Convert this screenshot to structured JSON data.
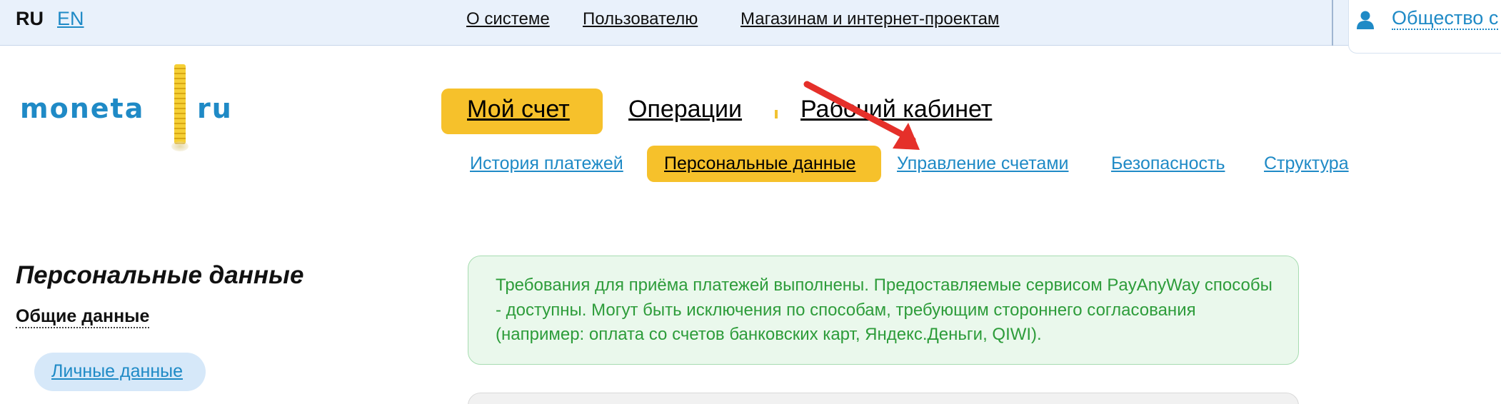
{
  "colors": {
    "accent_yellow": "#f6c12b",
    "link_blue": "#1f8ac6",
    "topbar_bg": "#e9f1fb",
    "notice_bg": "#eaf8ec",
    "notice_text": "#2d9c3a",
    "arrow_red": "#e5302a"
  },
  "topbar": {
    "lang_ru": "RU",
    "lang_en": "EN",
    "nav": [
      "О системе",
      "Пользователю",
      "Магазинам и интернет-проектам"
    ],
    "user_icon": "user-icon",
    "user_name": "Общество с"
  },
  "logo": {
    "left": "moneta",
    "right": "ru"
  },
  "main_nav": {
    "tabs": [
      "Мой счет",
      "Операции",
      "Рабочий кабинет"
    ],
    "active": "Мой счет"
  },
  "sub_nav": {
    "items": [
      "История платежей",
      "Персональные данные",
      "Управление счетами",
      "Безопасность",
      "Структура"
    ],
    "active": "Персональные данные"
  },
  "sidebar": {
    "title": "Персональные данные",
    "section": "Общие данные",
    "item": "Личные данные"
  },
  "notice": {
    "text": "Требования для приёма платежей выполнены. Предоставляемые сервисом PayAnyWay способы - доступны. Могут быть исключения по способам, требующим стороннего согласования (например: оплата со счетов банковских карт, Яндекс.Деньги, QIWI)."
  }
}
